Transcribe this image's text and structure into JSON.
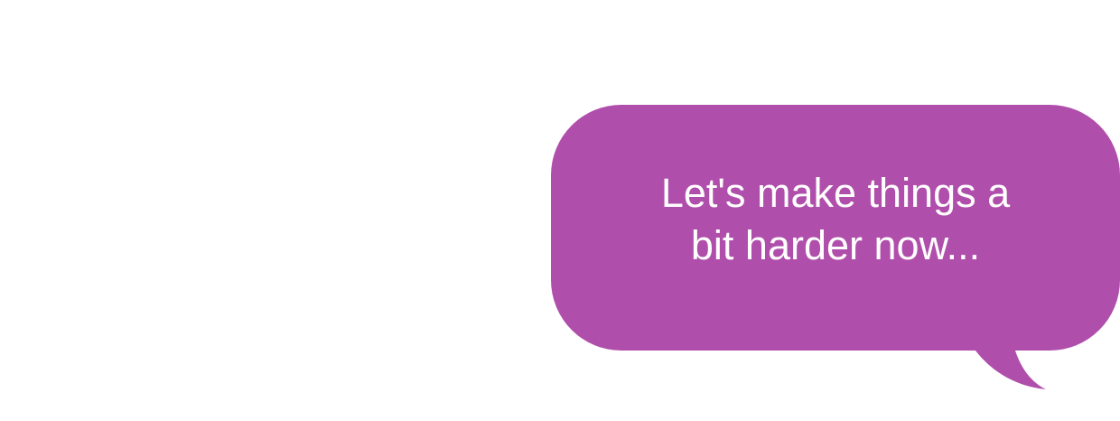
{
  "message": {
    "text": "Let's make things a\nbit harder now...",
    "bubble_color": "#b04fab",
    "text_color": "#ffffff",
    "background_color": "#ffffff"
  }
}
